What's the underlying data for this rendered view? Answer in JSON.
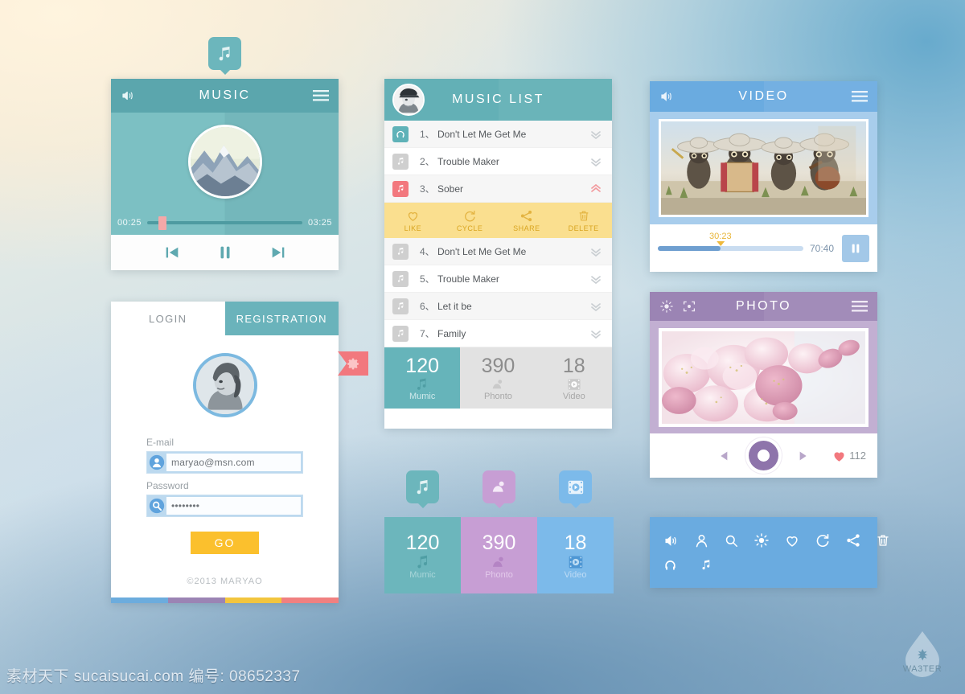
{
  "background": {
    "accent_teal": "#63b0b6",
    "accent_blue": "#6aabe0",
    "accent_purple": "#9b84b4",
    "accent_yellow": "#fbc02d",
    "accent_red": "#f2787e"
  },
  "music_player": {
    "title": "MUSIC",
    "volume_icon": "volume-icon",
    "menu_icon": "hamburger-menu-icon",
    "pin_icon": "music-note-pin-icon",
    "elapsed": "00:25",
    "duration": "03:25",
    "progress_percent": 7,
    "prev_icon": "previous-track-icon",
    "pause_icon": "pause-icon",
    "next_icon": "next-track-icon"
  },
  "login": {
    "tab_login": "LOGIN",
    "tab_registration": "REGISTRATION",
    "email_label": "E-mail",
    "email_value": "maryao@msn.com",
    "email_placeholder": "maryao@msn.com",
    "password_label": "Password",
    "password_value": "••••••••",
    "password_placeholder": "••••••••",
    "submit_label": "GO",
    "copyright": "©2013 MARYAO",
    "gear_icon": "gear-icon",
    "strip_colors": [
      "#6cacdd",
      "#9b84b4",
      "#f2c53e",
      "#f08080"
    ]
  },
  "music_list": {
    "title": "MUSIC LIST",
    "avatar_icon": "user-avatar",
    "items": [
      {
        "num": "1、",
        "name": "Don't Let Me Get Me",
        "badge": "teal",
        "expanded": false
      },
      {
        "num": "2、",
        "name": "Trouble Maker",
        "badge": "gray",
        "expanded": false
      },
      {
        "num": "3、",
        "name": "Sober",
        "badge": "red",
        "expanded": true
      },
      {
        "num": "4、",
        "name": "Don't Let Me Get Me",
        "badge": "gray",
        "expanded": false
      },
      {
        "num": "5、",
        "name": "Trouble Maker",
        "badge": "gray",
        "expanded": false
      },
      {
        "num": "6、",
        "name": "Let it be",
        "badge": "gray",
        "expanded": false
      },
      {
        "num": "7、",
        "name": "Family",
        "badge": "gray",
        "expanded": false
      }
    ],
    "actions": [
      {
        "label": "LIKE",
        "icon": "heart-icon"
      },
      {
        "label": "CYCLE",
        "icon": "repeat-icon"
      },
      {
        "label": "SHARE",
        "icon": "share-icon"
      },
      {
        "label": "DELETE",
        "icon": "trash-icon"
      }
    ],
    "stats": [
      {
        "num": "120",
        "label": "Mumic",
        "icon": "music-note-icon",
        "style": "teal"
      },
      {
        "num": "390",
        "label": "Phonto",
        "icon": "photo-icon",
        "style": "gray"
      },
      {
        "num": "18",
        "label": "Video",
        "icon": "video-icon",
        "style": "gray"
      }
    ]
  },
  "tiles": [
    {
      "num": "120",
      "label": "Mumic",
      "icon": "music-note-icon",
      "color": "#6cb6bc",
      "label_color": "#a9d6d9"
    },
    {
      "num": "390",
      "label": "Phonto",
      "icon": "photo-icon",
      "color": "#c79ed4",
      "label_color": "#e3c9ea"
    },
    {
      "num": "18",
      "label": "Video",
      "icon": "video-icon",
      "color": "#7cbaea",
      "label_color": "#bfdcf5"
    }
  ],
  "video": {
    "title": "VIDEO",
    "volume_icon": "volume-icon",
    "menu_icon": "hamburger-menu-icon",
    "current_time": "30:23",
    "duration": "70:40",
    "progress_percent": 43,
    "pause_icon": "pause-icon",
    "thumbnail": "mariachi-owls-illustration"
  },
  "photo": {
    "title": "PHOTO",
    "brightness_icon": "brightness-icon",
    "crop_icon": "crop-frame-icon",
    "menu_icon": "hamburger-menu-icon",
    "prev_icon": "previous-arrow-icon",
    "shutter_icon": "shutter-icon",
    "next_icon": "next-arrow-icon",
    "like_icon": "heart-filled-icon",
    "like_count": "112",
    "thumbnail": "cherry-blossom-photo"
  },
  "icon_palette": {
    "row1": [
      "volume-icon",
      "user-icon",
      "search-icon",
      "brightness-icon",
      "heart-icon",
      "repeat-icon",
      "share-icon",
      "trash-icon"
    ],
    "row2": [
      "headphones-icon",
      "music-note-icon"
    ]
  },
  "footer": {
    "watermark": "素材天下 sucaisucai.com  编号: 08652337",
    "logo_text": "WA3TER"
  }
}
